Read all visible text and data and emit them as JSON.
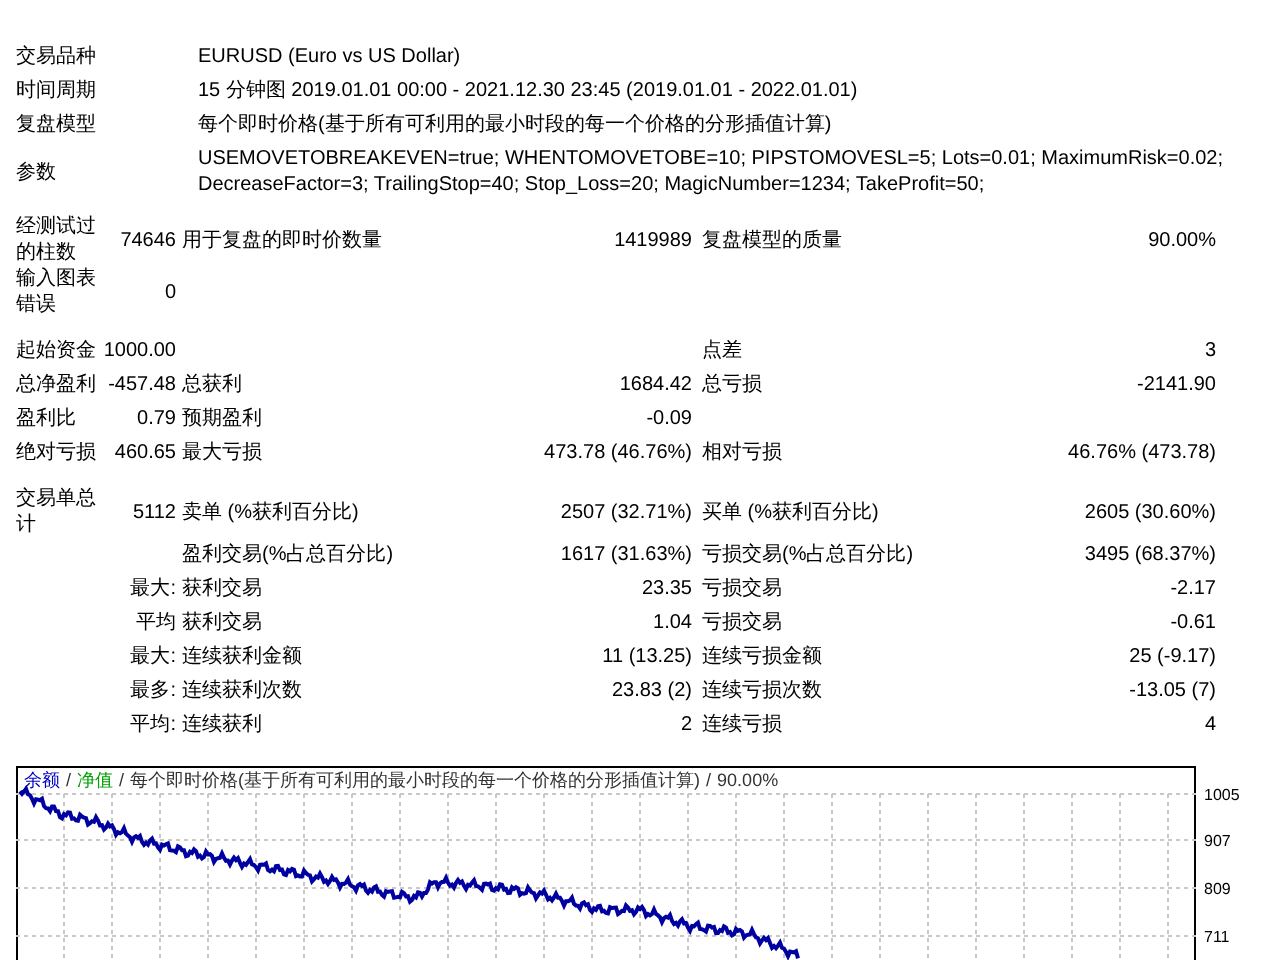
{
  "info": [
    {
      "label": "交易品种",
      "value": "EURUSD (Euro vs US Dollar)"
    },
    {
      "label": "时间周期",
      "value": "15 分钟图 2019.01.01 00:00 - 2021.12.30 23:45 (2019.01.01 - 2022.01.01)"
    },
    {
      "label": "复盘模型",
      "value": "每个即时价格(基于所有可利用的最小时段的每一个价格的分形插值计算)"
    },
    {
      "label": "参数",
      "value": "USEMOVETOBREAKEVEN=true; WHENTOMOVETOBE=10; PIPSTOMOVESL=5; Lots=0.01; MaximumRisk=0.02; DecreaseFactor=3; TrailingStop=40; Stop_Loss=20; MagicNumber=1234; TakeProfit=50;"
    }
  ],
  "sections": [
    [
      {
        "label_1": "经测试过的柱数",
        "value_1": "74646",
        "label_2": "用于复盘的即时价数量",
        "value_2": "1419989",
        "label_3": "复盘模型的质量",
        "value_3": "90.00%"
      },
      {
        "label_1": "输入图表错误",
        "value_1": "0"
      }
    ],
    [
      {
        "label_1": "起始资金",
        "value_1": "1000.00",
        "label_3": "点差",
        "value_3": "3"
      },
      {
        "label_1": "总净盈利",
        "value_1": "-457.48",
        "label_2": "总获利",
        "value_2": "1684.42",
        "label_3": "总亏损",
        "value_3": "-2141.90"
      },
      {
        "label_1": "盈利比",
        "value_1": "0.79",
        "label_2": "预期盈利",
        "value_2": "-0.09"
      },
      {
        "label_1": "绝对亏损",
        "value_1": "460.65",
        "label_2": "最大亏损",
        "value_2": "473.78 (46.76%)",
        "label_3": "相对亏损",
        "value_3": "46.76% (473.78)"
      }
    ],
    [
      {
        "label_1": "交易单总计",
        "value_1": "5112",
        "label_2": "卖单 (%获利百分比)",
        "value_2": "2507 (32.71%)",
        "label_3": "买单 (%获利百分比)",
        "value_3": "2605 (30.60%)"
      },
      {
        "label_2": "盈利交易(%占总百分比)",
        "value_2": "1617 (31.63%)",
        "label_3": "亏损交易(%占总百分比)",
        "value_3": "3495 (68.37%)"
      },
      {
        "value_1": "最大:",
        "label_2": "获利交易",
        "value_2": "23.35",
        "label_3": "亏损交易",
        "value_3": "-2.17"
      },
      {
        "value_1": "平均",
        "label_2": "获利交易",
        "value_2": "1.04",
        "label_3": "亏损交易",
        "value_3": "-0.61"
      },
      {
        "value_1": "最大:",
        "label_2": "连续获利金额",
        "value_2": "11 (13.25)",
        "label_3": "连续亏损金额",
        "value_3": "25 (-9.17)"
      },
      {
        "value_1": "最多:",
        "label_2": "连续获利次数",
        "value_2": "23.83 (2)",
        "label_3": "连续亏损次数",
        "value_3": "-13.05 (7)"
      },
      {
        "value_1": "平均:",
        "label_2": "连续获利",
        "value_2": "2",
        "label_3": "连续亏损",
        "value_3": "4"
      }
    ]
  ],
  "chart": {
    "legend": [
      {
        "label": "余额",
        "color": "#0000c0"
      },
      {
        "label": "净值",
        "color": "#00a000"
      }
    ],
    "separator": "/",
    "caption": "每个即时价格(基于所有可利用的最小时段的每一个价格的分形插值计算)",
    "quality": "90.00%",
    "y_ticks": [
      "1005",
      "907",
      "809",
      "711"
    ]
  }
}
